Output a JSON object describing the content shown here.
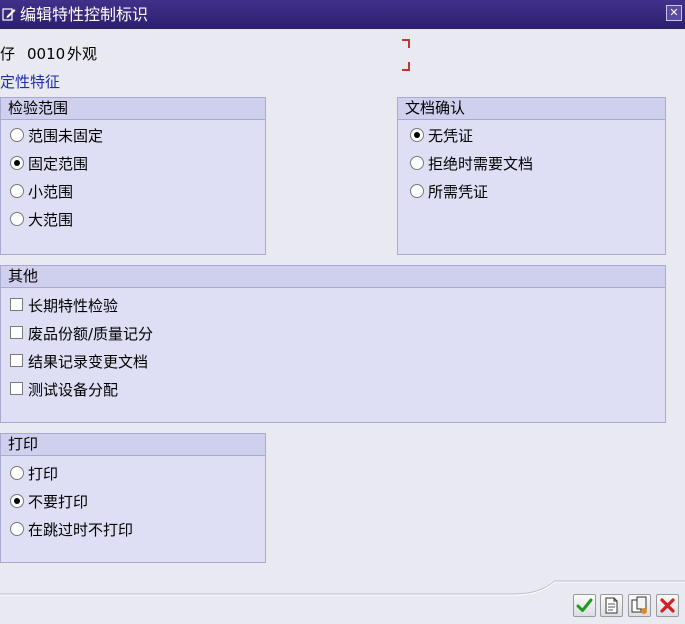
{
  "window": {
    "title": "编辑特性控制标识",
    "close_icon": "close-icon"
  },
  "header": {
    "field_label": "仔",
    "field_code": "0010",
    "field_desc": "外观",
    "section_link": "定性特征"
  },
  "groups": {
    "inspection_scope": {
      "title": "检验范围",
      "options": [
        "范围未固定",
        "固定范围",
        "小范围",
        "大范围"
      ],
      "selected": "固定范围"
    },
    "document_confirmation": {
      "title": "文档确认",
      "options": [
        "无凭证",
        "拒绝时需要文档",
        "所需凭证"
      ],
      "selected": "无凭证"
    },
    "other": {
      "title": "其他",
      "checkboxes": [
        {
          "label": "长期特性检验",
          "checked": false
        },
        {
          "label": "废品份额/质量记分",
          "checked": false
        },
        {
          "label": "结果记录变更文档",
          "checked": false
        },
        {
          "label": "测试设备分配",
          "checked": false
        }
      ]
    },
    "print": {
      "title": "打印",
      "options": [
        "打印",
        "不要打印",
        "在跳过时不打印"
      ],
      "selected": "不要打印"
    }
  },
  "toolbar": {
    "buttons": [
      "confirm-check-icon",
      "document-icon",
      "copy-document-icon",
      "cancel-x-icon"
    ]
  },
  "colors": {
    "titlebar": "#2c1f6e",
    "background": "#e9e9f1",
    "group_bg": "#dedff4",
    "group_header": "#cfd0ee",
    "link": "#1b2fb0",
    "accent_red": "#c0392b"
  }
}
